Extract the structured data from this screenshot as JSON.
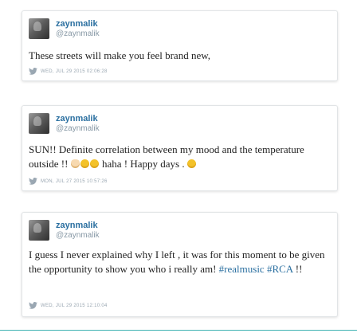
{
  "tweets": [
    {
      "name": "zaynmalik",
      "handle": "@zaynmalik",
      "text": "These streets will make you feel brand new,",
      "date": "WED, JUL 29 2015 02:06:28"
    },
    {
      "name": "zaynmalik",
      "handle": "@zaynmalik",
      "text_main": "SUN!! Definite correlation between my mood and the temperature outside !!",
      "text_mid": " haha ! Happy days .",
      "emojis_a": [
        "ok-hand",
        "smile",
        "smile"
      ],
      "emoji_b": "tongue-out",
      "date": "MON, JUL 27 2015 10:57:26"
    },
    {
      "name": "zaynmalik",
      "handle": "@zaynmalik",
      "text_main": "I guess I never explained why I left , it was for this moment to be given the opportunity to show you who i really am!",
      "hashtag1": "#realmusic",
      "hashtag2": "#RCA",
      "text_end": " !!",
      "date": "WED, JUL 29 2015 12:10:04"
    }
  ],
  "colors": {
    "link": "#2a6fa0",
    "meta": "#9aa7b2",
    "divider": "#3fb3b3"
  }
}
